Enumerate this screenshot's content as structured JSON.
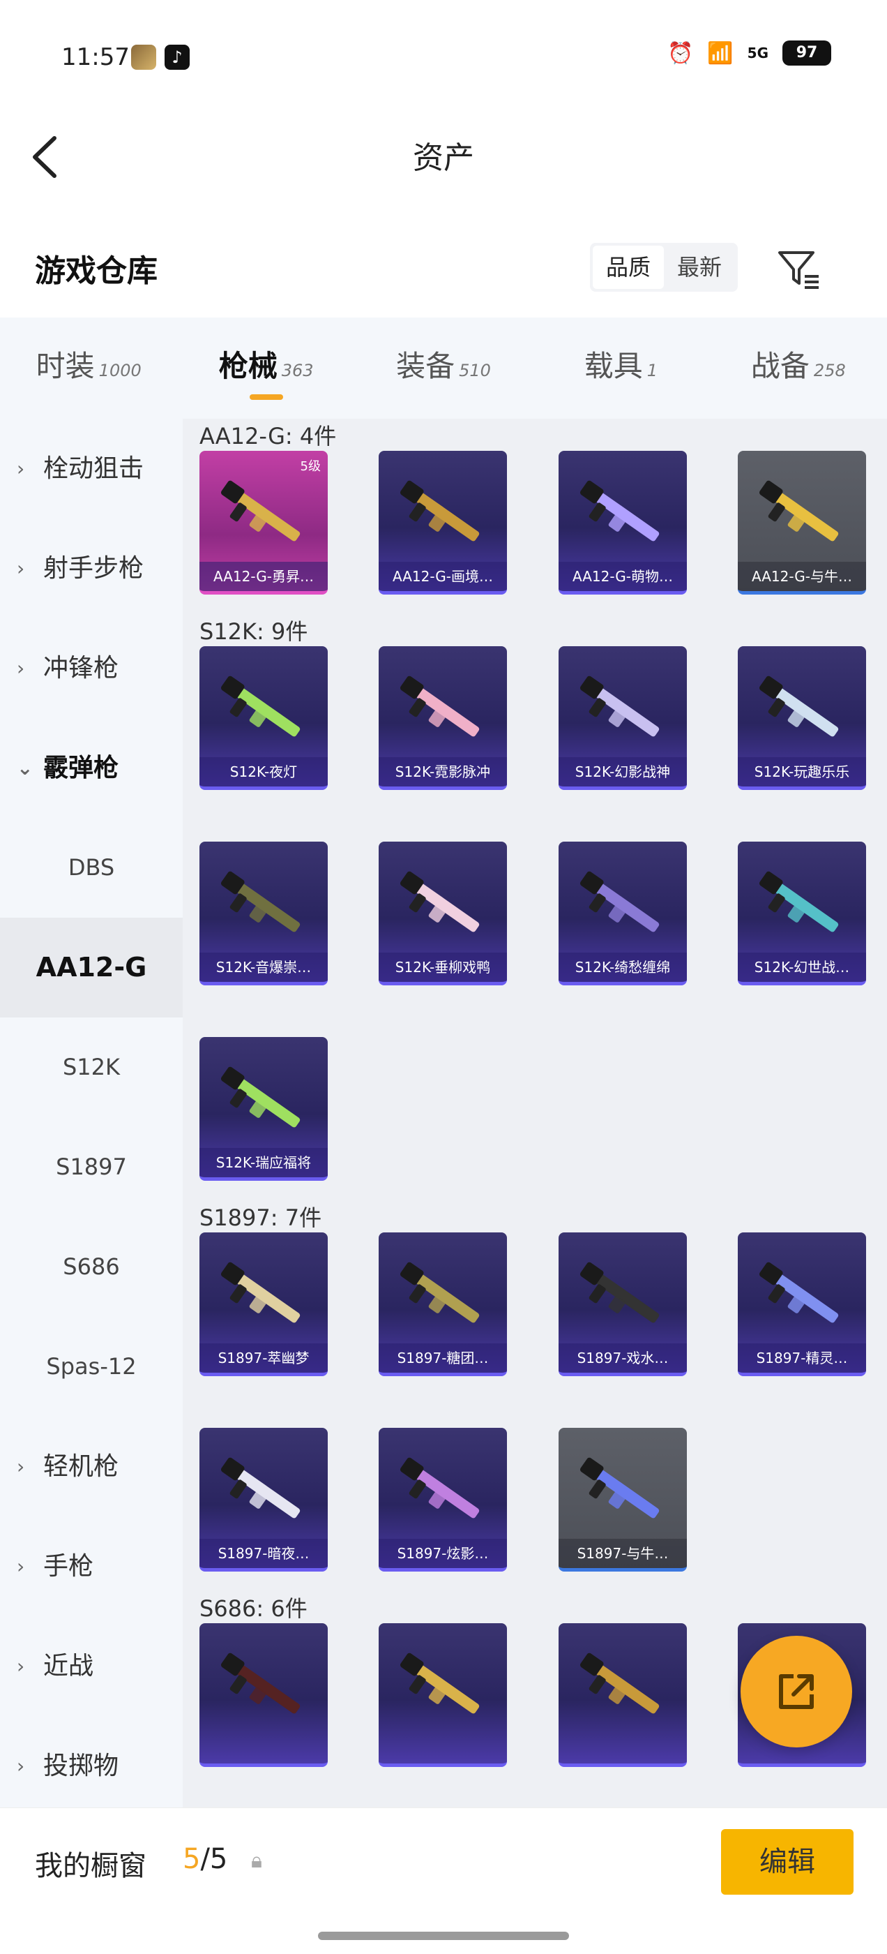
{
  "status": {
    "time": "11:57",
    "network": "5G",
    "battery": "97"
  },
  "header": {
    "title": "资产"
  },
  "warehouse": {
    "title": "游戏仓库",
    "sort": [
      "品质",
      "最新"
    ]
  },
  "tabs": [
    {
      "label": "时装",
      "count": "1000"
    },
    {
      "label": "枪械",
      "count": "363",
      "active": true
    },
    {
      "label": "装备",
      "count": "510"
    },
    {
      "label": "载具",
      "count": "1"
    },
    {
      "label": "战备",
      "count": "258"
    }
  ],
  "sidebar": {
    "items": [
      {
        "label": "栓动狙击"
      },
      {
        "label": "射手步枪"
      },
      {
        "label": "冲锋枪"
      },
      {
        "label": "霰弹枪"
      },
      {
        "label": "DBS"
      },
      {
        "label": "AA12-G"
      },
      {
        "label": "S12K"
      },
      {
        "label": "S1897"
      },
      {
        "label": "S686"
      },
      {
        "label": "Spas-12"
      },
      {
        "label": "轻机枪"
      },
      {
        "label": "手枪"
      },
      {
        "label": "近战"
      },
      {
        "label": "投掷物"
      }
    ]
  },
  "groups": [
    {
      "title": "AA12-G: 4件",
      "items": [
        {
          "name": "AA12-G-勇昇…",
          "badge": "5级",
          "style": "pink"
        },
        {
          "name": "AA12-G-画境…",
          "style": "purple"
        },
        {
          "name": "AA12-G-萌物…",
          "style": "purple"
        },
        {
          "name": "AA12-G-与牛…",
          "style": "grey"
        }
      ]
    },
    {
      "title": "S12K: 9件",
      "items": [
        {
          "name": "S12K-夜灯",
          "style": "purple"
        },
        {
          "name": "S12K-霓影脉冲",
          "style": "purple"
        },
        {
          "name": "S12K-幻影战神",
          "style": "purple"
        },
        {
          "name": "S12K-玩趣乐乐",
          "style": "purple"
        },
        {
          "name": "S12K-音爆崇…",
          "style": "purple"
        },
        {
          "name": "S12K-垂柳戏鸭",
          "style": "purple"
        },
        {
          "name": "S12K-绮愁缠绵",
          "style": "purple"
        },
        {
          "name": "S12K-幻世战…",
          "style": "purple"
        },
        {
          "name": "S12K-瑞应福将",
          "style": "purple"
        }
      ]
    },
    {
      "title": "S1897: 7件",
      "items": [
        {
          "name": "S1897-萃幽梦",
          "style": "purple"
        },
        {
          "name": "S1897-糖团…",
          "style": "purple"
        },
        {
          "name": "S1897-戏水…",
          "style": "purple"
        },
        {
          "name": "S1897-精灵…",
          "style": "purple"
        },
        {
          "name": "S1897-暗夜…",
          "style": "purple"
        },
        {
          "name": "S1897-炫影…",
          "style": "purple"
        },
        {
          "name": "S1897-与牛…",
          "style": "grey"
        }
      ]
    },
    {
      "title": "S686: 6件",
      "items": [
        {
          "name": "",
          "style": "purple"
        },
        {
          "name": "",
          "style": "purple"
        },
        {
          "name": "",
          "style": "purple"
        },
        {
          "name": "",
          "style": "purple"
        }
      ]
    }
  ],
  "bottom": {
    "label": "我的橱窗",
    "count_current": "5",
    "count_total": "/5",
    "edit": "编辑"
  }
}
